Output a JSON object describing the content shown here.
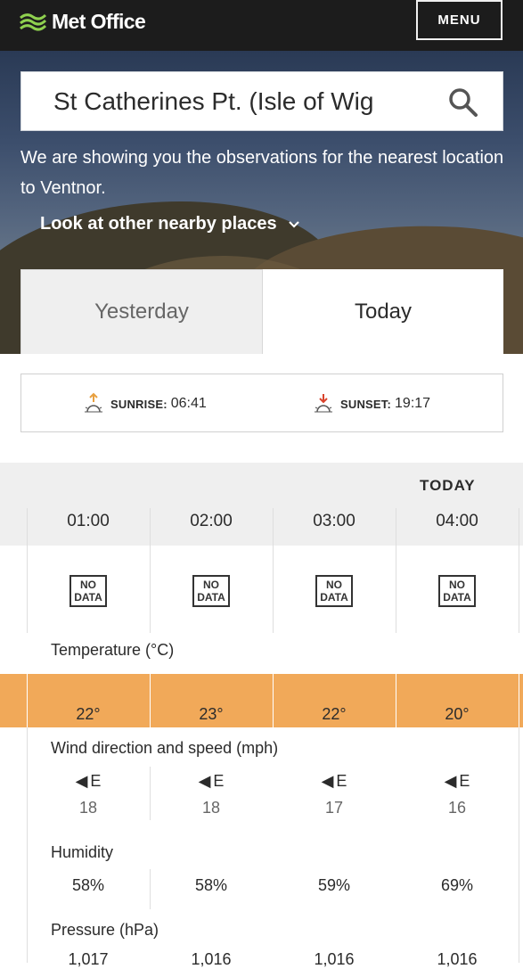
{
  "header": {
    "brand": "Met Office",
    "menu_label": "MENU"
  },
  "search": {
    "value": "St Catherines Pt. (Isle of Wig"
  },
  "notice": "We are showing you the observations for the nearest location to Ventnor.",
  "nearby_label": "Look at other nearby places",
  "tabs": [
    {
      "label": "Yesterday",
      "selected": false
    },
    {
      "label": "Today",
      "selected": true
    }
  ],
  "sun": {
    "sunrise_label": "SUNRISE:",
    "sunrise_time": "06:41",
    "sunset_label": "SUNSET:",
    "sunset_time": "19:17"
  },
  "table": {
    "day_label": "TODAY",
    "times": [
      "01:00",
      "02:00",
      "03:00",
      "04:00"
    ],
    "weather": [
      "NO DATA",
      "NO DATA",
      "NO DATA",
      "NO DATA"
    ],
    "temperature_label": "Temperature (°C)",
    "temperatures": [
      "22°",
      "23°",
      "22°",
      "20°"
    ],
    "wind_label": "Wind direction and speed (mph)",
    "wind_dirs": [
      "E",
      "E",
      "E",
      "E"
    ],
    "wind_speeds": [
      "18",
      "18",
      "17",
      "16"
    ],
    "humidity_label": "Humidity",
    "humidity": [
      "58%",
      "58%",
      "59%",
      "69%"
    ],
    "pressure_label": "Pressure (hPa)",
    "pressure": [
      "1,017",
      "1,016",
      "1,016",
      "1,016"
    ]
  },
  "colors": {
    "temp_high": "#ee9a47",
    "temp_low": "#f3ad5e",
    "band": "#efefef",
    "header": "#1c1c1c"
  },
  "icons": {
    "logo": "met-office-wave-icon",
    "search": "search-icon",
    "chevron": "chevron-down-icon",
    "sunrise": "sunrise-icon",
    "sunset": "sunset-icon",
    "wind": "wind-arrow-icon"
  }
}
